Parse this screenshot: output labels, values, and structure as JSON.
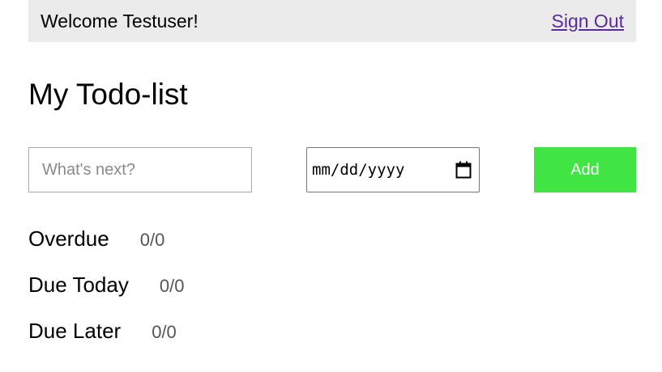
{
  "header": {
    "welcome_text": "Welcome Testuser!",
    "signout_label": "Sign Out"
  },
  "main": {
    "title": "My Todo-list",
    "new_todo": {
      "placeholder": "What's next?",
      "value": ""
    },
    "due_date": {
      "display": "mm/dd/yyyy",
      "icon": "calendar-icon"
    },
    "add_label": "Add",
    "sections": [
      {
        "label": "Overdue",
        "count": "0/0"
      },
      {
        "label": "Due Today",
        "count": "0/0"
      },
      {
        "label": "Due Later",
        "count": "0/0"
      }
    ]
  },
  "colors": {
    "header_bg": "#ebebeb",
    "link": "#5a2a9a",
    "add_button": "#40e544",
    "count_text": "#555555"
  }
}
